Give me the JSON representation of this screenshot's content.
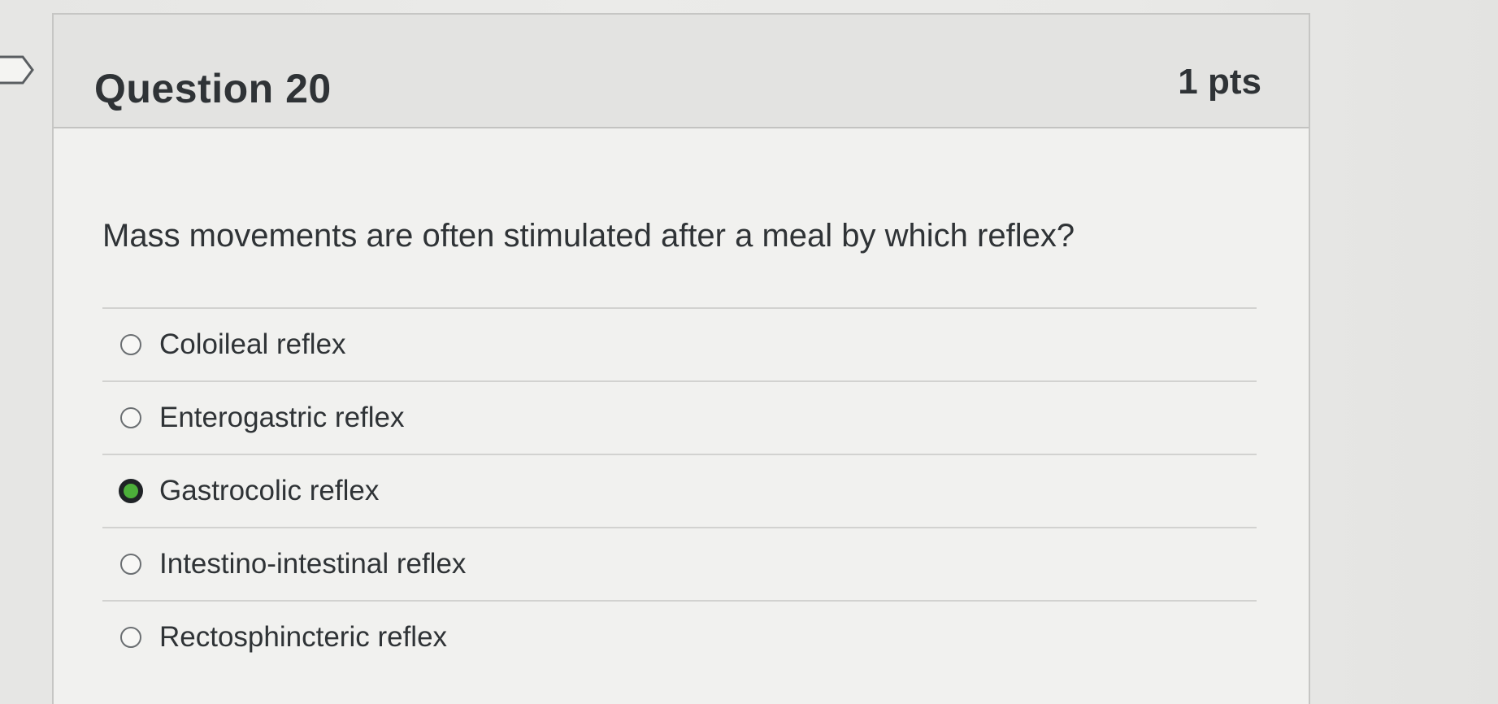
{
  "question": {
    "title": "Question 20",
    "points": "1 pts",
    "text": "Mass movements are often stimulated after a meal by which reflex?"
  },
  "answers": [
    {
      "label": "Coloileal reflex",
      "selected": false
    },
    {
      "label": "Enterogastric reflex",
      "selected": false
    },
    {
      "label": "Gastrocolic reflex",
      "selected": true
    },
    {
      "label": "Intestino-intestinal reflex",
      "selected": false
    },
    {
      "label": "Rectosphincteric reflex",
      "selected": false
    }
  ],
  "colors": {
    "selected_radio": "#4caf3a",
    "text": "#2f3336",
    "header_bg": "#e3e3e1"
  },
  "icons": {
    "flag": "flag-icon"
  }
}
